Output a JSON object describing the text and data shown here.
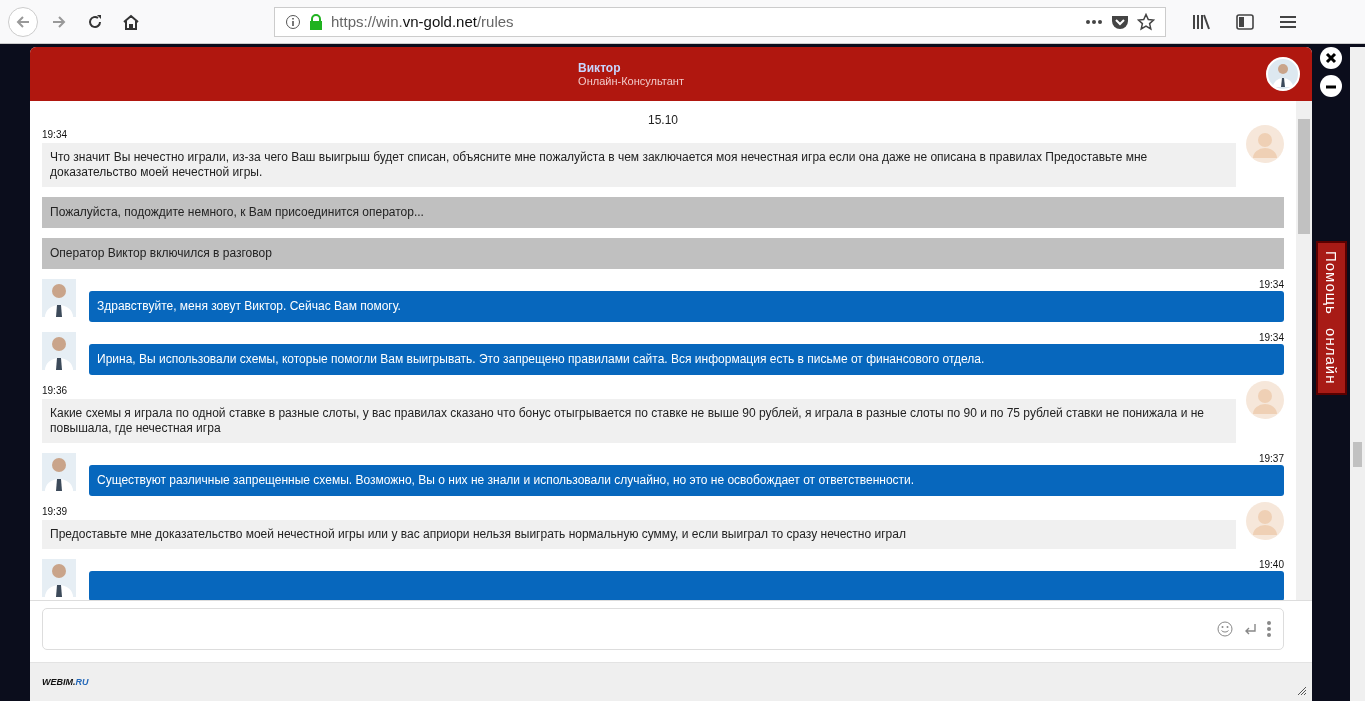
{
  "browser": {
    "url_prefix": "https://win.",
    "url_domain": "vn-gold.net",
    "url_path": "/rules"
  },
  "chat": {
    "operator_name": "Виктор",
    "operator_role": "Онлайн-Консультант",
    "date": "15.10",
    "messages": [
      {
        "kind": "visitor",
        "time": "19:34",
        "text": "Что значит Вы нечестно играли, из-за чего Ваш выигрыш будет списан, объясните мне пожалуйста в чем заключается моя нечестная игра если она даже не описана в правилах Предоставьте мне доказательство моей нечестной игры."
      },
      {
        "kind": "system",
        "text": "Пожалуйста, подождите немного, к Вам присоединится оператор..."
      },
      {
        "kind": "system",
        "text": "Оператор Виктор включился в разговор"
      },
      {
        "kind": "operator",
        "time": "19:34",
        "text": "Здравствуйте, меня зовут Виктор. Сейчас Вам помогу."
      },
      {
        "kind": "operator",
        "time": "19:34",
        "text": "Ирина, Вы использовали схемы, которые помогли Вам выигрывать. Это запрещено правилами сайта. Вся информация есть в письме от финансового отдела."
      },
      {
        "kind": "visitor",
        "time": "19:36",
        "text": "Какие схемы я играла по одной ставке в разные слоты, у вас правилах сказано что бонус отыгрывается по ставке не выше 90 рублей, я играла в разные слоты по 90 и по 75 рублей ставки не понижала и не повышала, где нечестная игра"
      },
      {
        "kind": "operator",
        "time": "19:37",
        "text": "Существуют различные запрещенные схемы. Возможно, Вы о них не знали и использовали случайно, но это не освобождает от ответственности."
      },
      {
        "kind": "visitor",
        "time": "19:39",
        "text": "Предоставьте мне доказательство моей нечестной игры или у вас априори нельзя выиграть нормальную сумму, и если выиграл то сразу нечестно играл"
      },
      {
        "kind": "operator",
        "time": "19:40"
      }
    ],
    "brand_main": "WEBIM.",
    "brand_suffix": "RU"
  },
  "help_tab": "Помощь онлайн"
}
